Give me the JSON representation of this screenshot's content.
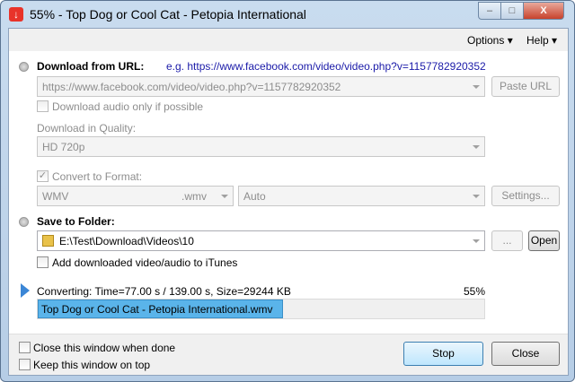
{
  "window": {
    "title": "55% - Top Dog or Cool Cat  - Petopia International",
    "minimize": "‒",
    "maximize": "□",
    "close": "X"
  },
  "menu": {
    "options": "Options",
    "help": "Help"
  },
  "download": {
    "label": "Download from URL:",
    "example": "e.g. https://www.facebook.com/video/video.php?v=1157782920352",
    "url": "https://www.facebook.com/video/video.php?v=1157782920352",
    "paste": "Paste URL",
    "audio_only": "Download audio only if possible",
    "audio_only_checked": false
  },
  "quality": {
    "label": "Download in Quality:",
    "value": "HD 720p"
  },
  "convert": {
    "label": "Convert to Format:",
    "checked": true,
    "format": "WMV",
    "ext": ".wmv",
    "preset": "Auto",
    "settings": "Settings..."
  },
  "save": {
    "label": "Save to Folder:",
    "folder": "E:\\Test\\Download\\Videos\\10",
    "browse": "...",
    "open": "Open",
    "itunes": "Add downloaded video/audio to iTunes",
    "itunes_checked": false
  },
  "progress": {
    "status": "Converting: Time=77.00 s / 139.00 s, Size=29244 KB",
    "percent_label": "55%",
    "percent": 55,
    "file": "Top Dog or Cool Cat  - Petopia International.wmv",
    "fill_color": "#5ab4ea"
  },
  "footer": {
    "close_when_done": "Close this window when done",
    "keep_on_top": "Keep this window on top",
    "stop": "Stop",
    "close": "Close"
  }
}
